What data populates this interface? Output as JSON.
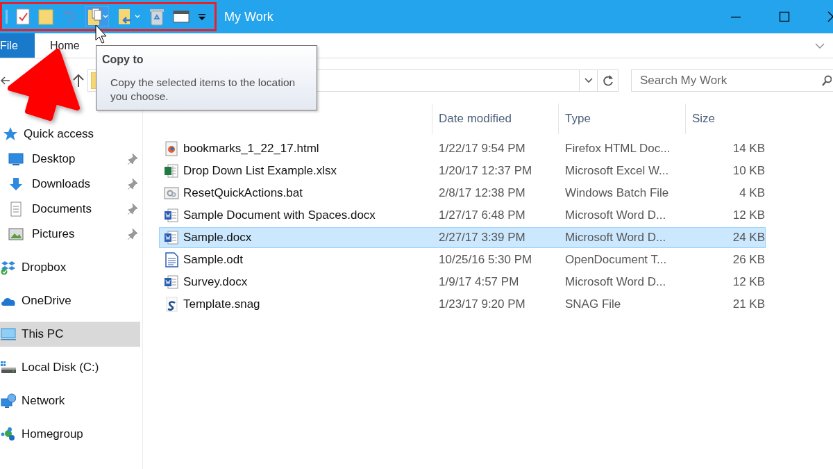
{
  "window": {
    "title": "My Work"
  },
  "ribbon": {
    "tabs": [
      {
        "label": "File",
        "kind": "file"
      },
      {
        "label": "Home",
        "kind": "plain"
      }
    ]
  },
  "search": {
    "placeholder": "Search My Work"
  },
  "tooltip": {
    "title": "Copy to",
    "text": "Copy the selected items to the location you choose."
  },
  "sidebar": {
    "items": [
      {
        "label": "Quick access",
        "kind": "star",
        "pinned": false,
        "selected": false
      },
      {
        "label": "Desktop",
        "kind": "desktop",
        "pinned": true,
        "selected": false
      },
      {
        "label": "Downloads",
        "kind": "downloads",
        "pinned": true,
        "selected": false
      },
      {
        "label": "Documents",
        "kind": "documents",
        "pinned": true,
        "selected": false
      },
      {
        "label": "Pictures",
        "kind": "pictures",
        "pinned": true,
        "selected": false
      },
      {
        "label": "Dropbox",
        "kind": "dropbox",
        "pinned": false,
        "selected": false
      },
      {
        "label": "OneDrive",
        "kind": "cloud",
        "pinned": false,
        "selected": false
      },
      {
        "label": "This PC",
        "kind": "pc",
        "pinned": false,
        "selected": true
      },
      {
        "label": "Local Disk (C:)",
        "kind": "disk",
        "pinned": false,
        "selected": false
      },
      {
        "label": "Network",
        "kind": "network",
        "pinned": false,
        "selected": false
      },
      {
        "label": "Homegroup",
        "kind": "homegroup",
        "pinned": false,
        "selected": false
      }
    ]
  },
  "table": {
    "columns": [
      "Date modified",
      "Type",
      "Size"
    ],
    "rows": [
      {
        "name": "bookmarks_1_22_17.html",
        "kind": "browser",
        "date": "1/22/17 9:54 PM",
        "type": "Firefox HTML Doc...",
        "size": "14 KB",
        "selected": false
      },
      {
        "name": "Drop Down List Example.xlsx",
        "kind": "sheet",
        "date": "1/20/17 12:37 PM",
        "type": "Microsoft Excel W...",
        "size": "10 KB",
        "selected": false
      },
      {
        "name": "ResetQuickActions.bat",
        "kind": "batch",
        "date": "2/8/17 12:38 PM",
        "type": "Windows Batch File",
        "size": "4 KB",
        "selected": false
      },
      {
        "name": "Sample Document with Spaces.docx",
        "kind": "word",
        "date": "1/27/17 6:48 PM",
        "type": "Microsoft Word D...",
        "size": "12 KB",
        "selected": false
      },
      {
        "name": "Sample.docx",
        "kind": "word",
        "date": "2/27/17 3:39 PM",
        "type": "Microsoft Word D...",
        "size": "24 KB",
        "selected": true
      },
      {
        "name": "Sample.odt",
        "kind": "odt",
        "date": "10/25/16 5:30 PM",
        "type": "OpenDocument T...",
        "size": "26 KB",
        "selected": false
      },
      {
        "name": "Survey.docx",
        "kind": "word",
        "date": "1/9/17 4:57 PM",
        "type": "Microsoft Word D...",
        "size": "12 KB",
        "selected": false
      },
      {
        "name": "Template.snag",
        "kind": "snag",
        "date": "1/23/17 9:20 PM",
        "type": "SNAG File",
        "size": "21 KB",
        "selected": false
      }
    ]
  }
}
